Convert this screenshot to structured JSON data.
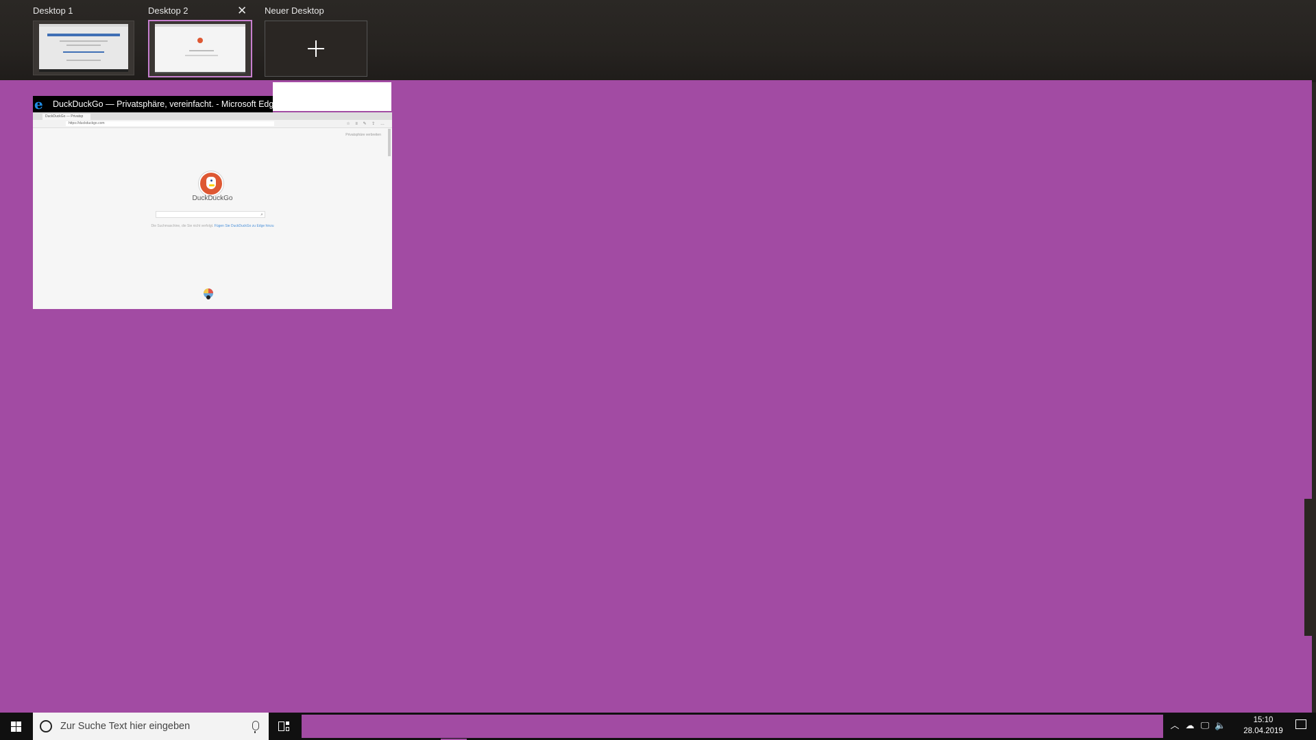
{
  "task_view": {
    "desktops": [
      {
        "label": "Desktop 1",
        "active": false
      },
      {
        "label": "Desktop 2",
        "active": true
      }
    ],
    "new_desktop_label": "Neuer Desktop",
    "close_glyph": "✕",
    "plus_icon": "plus-icon"
  },
  "window": {
    "title": "DuckDuckGo — Privatsphäre, vereinfacht. - Microsoft Edge",
    "app_icon": "edge-icon",
    "content": {
      "site_name": "DuckDuckGo",
      "url": "https://duckduckgo.com",
      "tab_label": "DuckDuckGo — Privatsp",
      "note_prefix": "Die Suchmaschine, die Sie nicht verfolgt.",
      "note_link": "Fügen Sie DuckDuckGo zu Edge hinzu",
      "top_links": "Privatsphäre verbreiten"
    }
  },
  "taskbar": {
    "search_placeholder": "Zur Suche Text hier eingeben",
    "clock_time": "15:10",
    "clock_date": "28.04.2019",
    "tray_icons": [
      "chevron-up-icon",
      "onedrive-icon",
      "network-icon",
      "volume-icon"
    ]
  },
  "colors": {
    "desktop_bg": "#a24ba3",
    "accent": "#c77fcf",
    "taskbar": "#101010"
  }
}
